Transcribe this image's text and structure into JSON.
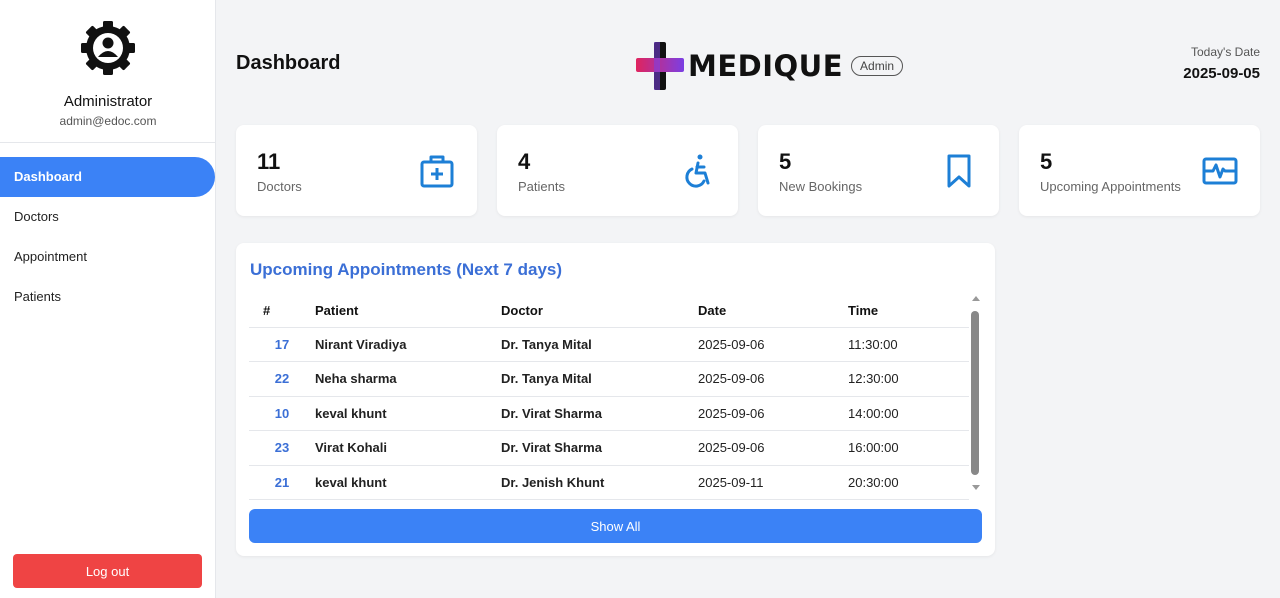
{
  "colors": {
    "accent": "#3b82f6",
    "title_blue": "#3b6fd6",
    "logout": "#ef4444",
    "icon_blue": "#1d7fd6"
  },
  "sidebar": {
    "profile": {
      "name": "Administrator",
      "email": "admin@edoc.com",
      "icon": "user-gear-icon"
    },
    "items": [
      {
        "label": "Dashboard",
        "active": true
      },
      {
        "label": "Doctors",
        "active": false
      },
      {
        "label": "Appointment",
        "active": false
      },
      {
        "label": "Patients",
        "active": false
      }
    ],
    "logout_label": "Log out"
  },
  "header": {
    "title": "Dashboard",
    "brand": {
      "name": "MEDIQUE",
      "badge": "Admin"
    },
    "date_label": "Today's Date",
    "date_value": "2025-09-05"
  },
  "stats": [
    {
      "count": "11",
      "label": "Doctors",
      "icon": "medical-kit-icon"
    },
    {
      "count": "4",
      "label": "Patients",
      "icon": "wheelchair-icon"
    },
    {
      "count": "5",
      "label": "New Bookings",
      "icon": "bookmark-icon"
    },
    {
      "count": "5",
      "label": "Upcoming Appointments",
      "icon": "heartbeat-monitor-icon"
    }
  ],
  "appointments": {
    "title": "Upcoming Appointments (Next 7 days)",
    "columns": [
      "#",
      "Patient",
      "Doctor",
      "Date",
      "Time"
    ],
    "rows": [
      {
        "id": "17",
        "patient": "Nirant Viradiya",
        "doctor": "Dr. Tanya Mital",
        "date": "2025-09-06",
        "time": "11:30:00"
      },
      {
        "id": "22",
        "patient": "Neha sharma",
        "doctor": "Dr. Tanya Mital",
        "date": "2025-09-06",
        "time": "12:30:00"
      },
      {
        "id": "10",
        "patient": "keval khunt",
        "doctor": "Dr. Virat Sharma",
        "date": "2025-09-06",
        "time": "14:00:00"
      },
      {
        "id": "23",
        "patient": "Virat Kohali",
        "doctor": "Dr. Virat Sharma",
        "date": "2025-09-06",
        "time": "16:00:00"
      },
      {
        "id": "21",
        "patient": "keval khunt",
        "doctor": "Dr. Jenish Khunt",
        "date": "2025-09-11",
        "time": "20:30:00"
      }
    ],
    "show_all_label": "Show All"
  }
}
